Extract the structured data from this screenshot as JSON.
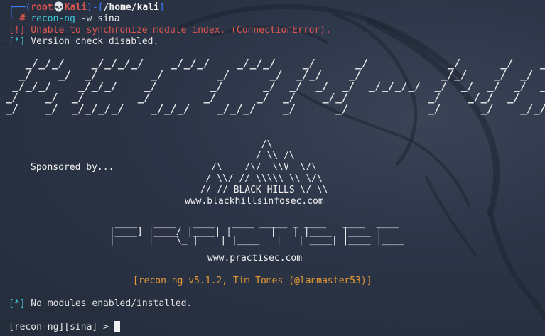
{
  "prompt": {
    "box_top": "┌──(",
    "user": "root",
    "skull": "💀",
    "host": "Kali",
    "sep": ")-[",
    "path": "/home/kali",
    "close": "]",
    "box_bottom": "└─",
    "hash": "#",
    "command": "recon-ng",
    "flag": "-w",
    "arg": "sina"
  },
  "messages": {
    "error": "[!] Unable to synchronize module index. (ConnectionError).",
    "version_prefix": "[*]",
    "version_text": " Version check disabled."
  },
  "banner": {
    "art": "   _/_/_/    _/_/_/_/    _/_/_/    _/_/_/    _/      _/            _/      _/    _/_/_/\n  _/    _/  _/        _/        _/      _/  _/_/    _/            _/_/    _/  _/\n _/_/_/    _/_/_/    _/        _/      _/  _/  _/  _/  _/_/_/_/  _/  _/  _/  _/  _/_/_/\n_/    _/  _/        _/        _/      _/  _/    _/_/            _/    _/_/  _/      _/\n_/    _/  _/_/_/_/    _/_/_/    _/_/_/    _/      _/            _/      _/    _/_/_/"
  },
  "sponsor": {
    "label": "Sponsored by...",
    "bh_art": "             /\\\n            / \\\\ /\\\n    /\\    /\\/  \\\\V  \\/\\\n   / \\\\/ // \\\\\\\\\\ \\\\ \\/\\\n  // // BLACK HILLS \\/ \\\\",
    "bh_url": "www.blackhillsinfosec.com",
    "ps_art": "  ____   ____   ____   ____ _____ _ ____   ____  ____\n |____] |____/ |____| |       |   | |____  |____ |\n |      |    \\_ |    | |____   |   | ____| |____ |____",
    "ps_url": "www.practisec.com"
  },
  "version": {
    "text": "[recon-ng v5.1.2, Tim Tomes (@lanmaster53)]"
  },
  "modules": {
    "prefix": "[*]",
    "text": " No modules enabled/installed."
  },
  "shell": {
    "prompt": "[recon-ng][sina] > "
  },
  "colors": {
    "background": "#283142",
    "prompt_blue": "#3d7eff",
    "error_red": "#e0564f",
    "info_cyan": "#3ec7d6",
    "version_orange": "#e59a36"
  }
}
